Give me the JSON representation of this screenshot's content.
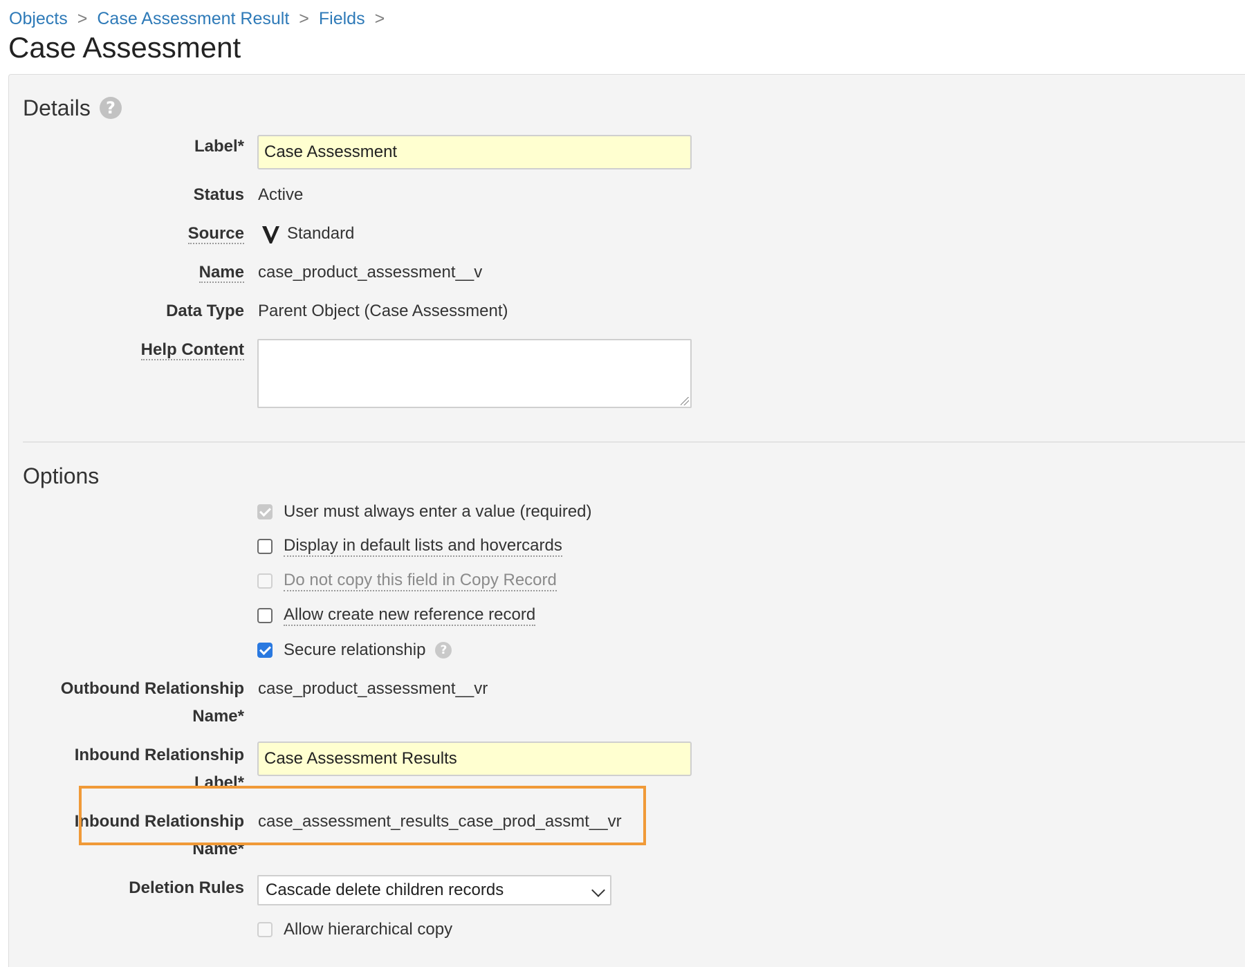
{
  "breadcrumb": {
    "items": [
      "Objects",
      "Case Assessment Result",
      "Fields"
    ],
    "separator": ">"
  },
  "page_title": "Case Assessment",
  "details": {
    "heading": "Details",
    "label_field": {
      "label": "Label*",
      "value": "Case Assessment"
    },
    "status": {
      "label": "Status",
      "value": "Active"
    },
    "source": {
      "label": "Source",
      "value": "Standard",
      "icon": "veeva-logo-icon"
    },
    "name": {
      "label": "Name",
      "value": "case_product_assessment__v"
    },
    "data_type": {
      "label": "Data Type",
      "value": "Parent Object (Case Assessment)"
    },
    "help_content": {
      "label": "Help Content",
      "value": ""
    }
  },
  "options": {
    "heading": "Options",
    "checkboxes": [
      {
        "label": "User must always enter a value (required)",
        "checked": true,
        "disabled": true
      },
      {
        "label": "Display in default lists and hovercards",
        "checked": false,
        "disabled": false
      },
      {
        "label": "Do not copy this field in Copy Record",
        "checked": false,
        "disabled": true
      },
      {
        "label": "Allow create new reference record",
        "checked": false,
        "disabled": false
      },
      {
        "label": "Secure relationship",
        "checked": true,
        "disabled": false
      }
    ],
    "outbound_name": {
      "label_line1": "Outbound Relationship",
      "label_line2": "Name*",
      "value": "case_product_assessment__vr"
    },
    "inbound_label": {
      "label_line1": "Inbound Relationship",
      "label_line2": "Label*",
      "value": "Case Assessment Results"
    },
    "inbound_name": {
      "label_line1": "Inbound Relationship",
      "label_line2": "Name*",
      "value": "case_assessment_results_case_prod_assmt__vr"
    },
    "deletion_rules": {
      "label": "Deletion Rules",
      "value": "Cascade delete children records"
    },
    "hierarchical_copy": {
      "label": "Allow hierarchical copy",
      "checked": false
    }
  },
  "colors": {
    "link": "#2e7ab8",
    "required_input": "#ffffd0",
    "highlight": "#f09a38",
    "checkbox_checked": "#2a79e0"
  }
}
